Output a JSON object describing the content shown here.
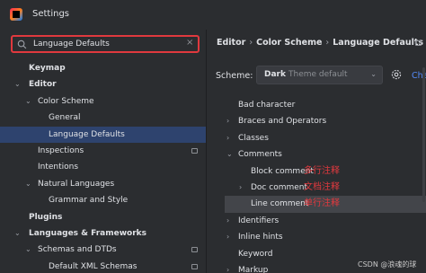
{
  "window": {
    "title": "Settings"
  },
  "search": {
    "value": "Language Defaults",
    "placeholder": ""
  },
  "tree": [
    {
      "label": "Keymap",
      "indent": 0,
      "arrow": "",
      "bold": true,
      "selected": false,
      "project_icon": false
    },
    {
      "label": "Editor",
      "indent": 0,
      "arrow": "⌄",
      "bold": true,
      "selected": false,
      "project_icon": false
    },
    {
      "label": "Color Scheme",
      "indent": 1,
      "arrow": "⌄",
      "bold": false,
      "selected": false,
      "project_icon": false
    },
    {
      "label": "General",
      "indent": 2,
      "arrow": "",
      "bold": false,
      "selected": false,
      "project_icon": false
    },
    {
      "label": "Language Defaults",
      "indent": 2,
      "arrow": "",
      "bold": false,
      "selected": true,
      "project_icon": false
    },
    {
      "label": "Inspections",
      "indent": 1,
      "arrow": "",
      "bold": false,
      "selected": false,
      "project_icon": true
    },
    {
      "label": "Intentions",
      "indent": 1,
      "arrow": "",
      "bold": false,
      "selected": false,
      "project_icon": false
    },
    {
      "label": "Natural Languages",
      "indent": 1,
      "arrow": "⌄",
      "bold": false,
      "selected": false,
      "project_icon": false
    },
    {
      "label": "Grammar and Style",
      "indent": 2,
      "arrow": "",
      "bold": false,
      "selected": false,
      "project_icon": false
    },
    {
      "label": "Plugins",
      "indent": 0,
      "arrow": "",
      "bold": true,
      "selected": false,
      "project_icon": false
    },
    {
      "label": "Languages & Frameworks",
      "indent": 0,
      "arrow": "⌄",
      "bold": true,
      "selected": false,
      "project_icon": false
    },
    {
      "label": "Schemas and DTDs",
      "indent": 1,
      "arrow": "⌄",
      "bold": false,
      "selected": false,
      "project_icon": true
    },
    {
      "label": "Default XML Schemas",
      "indent": 2,
      "arrow": "",
      "bold": false,
      "selected": false,
      "project_icon": true
    }
  ],
  "breadcrumb": {
    "part1": "Editor",
    "sep": "›",
    "part2": "Color Scheme",
    "part3": "Language Defaults"
  },
  "scheme": {
    "label": "Scheme:",
    "name": "Dark",
    "sub": "Theme default",
    "extra": "Cha"
  },
  "list": [
    {
      "label": "Bad character",
      "indent": 0,
      "arrow": "",
      "note": "",
      "selected": false
    },
    {
      "label": "Braces and Operators",
      "indent": 0,
      "arrow": "›",
      "note": "",
      "selected": false
    },
    {
      "label": "Classes",
      "indent": 0,
      "arrow": "›",
      "note": "",
      "selected": false
    },
    {
      "label": "Comments",
      "indent": 0,
      "arrow": "⌄",
      "note": "",
      "selected": false
    },
    {
      "label": "Block comment",
      "indent": 1,
      "arrow": "",
      "note": "多行注释",
      "selected": false
    },
    {
      "label": "Doc comment",
      "indent": 1,
      "arrow": "›",
      "note": "文档注释",
      "selected": false
    },
    {
      "label": "Line comment",
      "indent": 1,
      "arrow": "",
      "note": "单行注释",
      "selected": true
    },
    {
      "label": "Identifiers",
      "indent": 0,
      "arrow": "›",
      "note": "",
      "selected": false
    },
    {
      "label": "Inline hints",
      "indent": 0,
      "arrow": "›",
      "note": "",
      "selected": false
    },
    {
      "label": "Keyword",
      "indent": 0,
      "arrow": "",
      "note": "",
      "selected": false
    },
    {
      "label": "Markup",
      "indent": 0,
      "arrow": "›",
      "note": "",
      "selected": false
    }
  ],
  "watermark": "CSDN @浪魂的球",
  "icons": {
    "search": "search-icon",
    "clear": "close-icon",
    "gear": "gear-icon",
    "logo": "app-logo-icon"
  },
  "colors": {
    "selection": "#2e436e",
    "annotation": "#e0393e",
    "highlight_border": "#e0393e"
  }
}
